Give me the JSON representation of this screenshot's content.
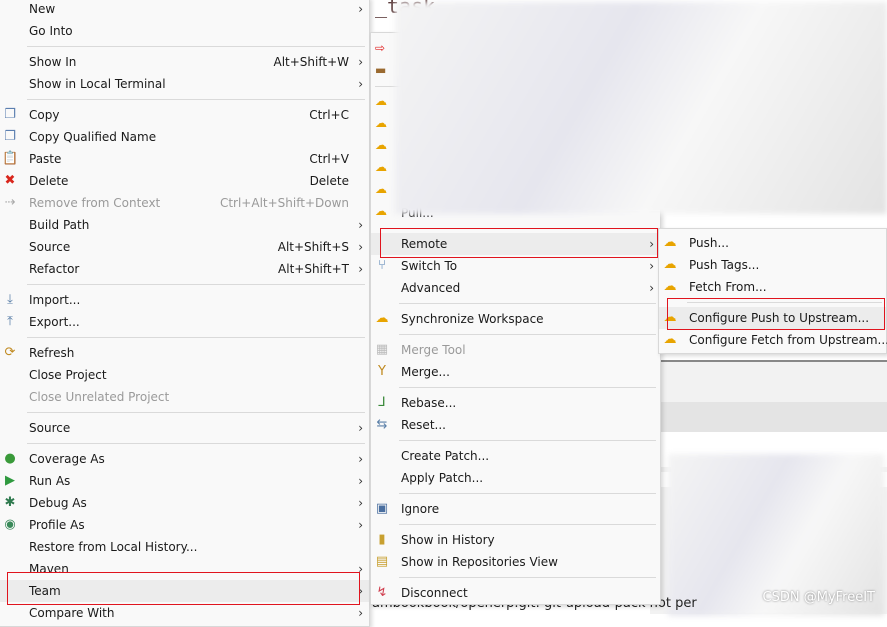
{
  "background": {
    "code_text": "_task   ...",
    "bottom_text": "ambookbook/openerp.git: git-upload-pack not per",
    "watermark": "CSDN @MyFreeIT"
  },
  "context_menu": {
    "items": [
      {
        "label": "New",
        "submenu": true
      },
      {
        "label": "Go Into"
      },
      {
        "sep": true
      },
      {
        "label": "Show In",
        "shortcut": "Alt+Shift+W",
        "submenu": true
      },
      {
        "label": "Show in Local Terminal",
        "submenu": true
      },
      {
        "sep": true
      },
      {
        "label": "Copy",
        "shortcut": "Ctrl+C",
        "icon": "copy-icon"
      },
      {
        "label": "Copy Qualified Name",
        "icon": "copy-qualified-icon"
      },
      {
        "label": "Paste",
        "shortcut": "Ctrl+V",
        "icon": "paste-icon"
      },
      {
        "label": "Delete",
        "shortcut": "Delete",
        "icon": "delete-icon"
      },
      {
        "label": "Remove from Context",
        "shortcut": "Ctrl+Alt+Shift+Down",
        "disabled": true,
        "icon": "remove-context-icon"
      },
      {
        "label": "Build Path",
        "submenu": true
      },
      {
        "label": "Source",
        "shortcut": "Alt+Shift+S",
        "submenu": true
      },
      {
        "label": "Refactor",
        "shortcut": "Alt+Shift+T",
        "submenu": true
      },
      {
        "sep": true
      },
      {
        "label": "Import...",
        "icon": "import-icon"
      },
      {
        "label": "Export...",
        "icon": "export-icon"
      },
      {
        "sep": true
      },
      {
        "label": "Refresh",
        "icon": "refresh-icon"
      },
      {
        "label": "Close Project"
      },
      {
        "label": "Close Unrelated Project",
        "disabled": true
      },
      {
        "sep": true
      },
      {
        "label": "Source",
        "submenu": true
      },
      {
        "sep": true
      },
      {
        "label": "Coverage As",
        "submenu": true,
        "icon": "coverage-icon"
      },
      {
        "label": "Run As",
        "submenu": true,
        "icon": "run-icon"
      },
      {
        "label": "Debug As",
        "submenu": true,
        "icon": "debug-icon"
      },
      {
        "label": "Profile As",
        "submenu": true,
        "icon": "profile-icon"
      },
      {
        "label": "Restore from Local History..."
      },
      {
        "label": "Maven",
        "submenu": true
      },
      {
        "label": "Team",
        "submenu": true,
        "highlighted": true
      },
      {
        "label": "Compare With",
        "submenu": true
      }
    ]
  },
  "team_menu": {
    "top_icons": [
      "commit-icon",
      "stash-icon",
      "sep",
      "push-upstream-icon",
      "fetch-upstream-icon",
      "fetch-icon",
      "push-icon",
      "pull-icon",
      "pull-dialog-icon"
    ],
    "items": [
      {
        "label": "Pull..."
      },
      {
        "sep": true
      },
      {
        "label": "Remote",
        "submenu": true,
        "highlighted": true
      },
      {
        "label": "Switch To",
        "submenu": true,
        "icon": "switch-icon"
      },
      {
        "label": "Advanced",
        "submenu": true
      },
      {
        "sep": true
      },
      {
        "label": "Synchronize Workspace",
        "icon": "synchronize-icon"
      },
      {
        "sep": true
      },
      {
        "label": "Merge Tool",
        "disabled": true,
        "icon": "merge-tool-icon"
      },
      {
        "label": "Merge...",
        "icon": "merge-icon"
      },
      {
        "sep": true
      },
      {
        "label": "Rebase...",
        "icon": "rebase-icon"
      },
      {
        "label": "Reset...",
        "icon": "reset-icon"
      },
      {
        "sep": true
      },
      {
        "label": "Create Patch..."
      },
      {
        "label": "Apply Patch..."
      },
      {
        "sep": true
      },
      {
        "label": "Ignore",
        "icon": "ignore-icon"
      },
      {
        "sep": true
      },
      {
        "label": "Show in History",
        "icon": "history-icon"
      },
      {
        "label": "Show in Repositories View",
        "icon": "repositories-icon"
      },
      {
        "sep": true
      },
      {
        "label": "Disconnect",
        "icon": "disconnect-icon"
      }
    ]
  },
  "remote_menu": {
    "items": [
      {
        "label": "Push...",
        "icon": "push-icon"
      },
      {
        "label": "Push Tags...",
        "icon": "push-tags-icon"
      },
      {
        "label": "Fetch From...",
        "icon": "fetch-icon"
      },
      {
        "sep": true
      },
      {
        "label": "Configure Push to Upstream...",
        "icon": "push-upstream-icon",
        "highlighted": true
      },
      {
        "label": "Configure Fetch from Upstream...",
        "icon": "fetch-upstream-icon"
      }
    ]
  }
}
